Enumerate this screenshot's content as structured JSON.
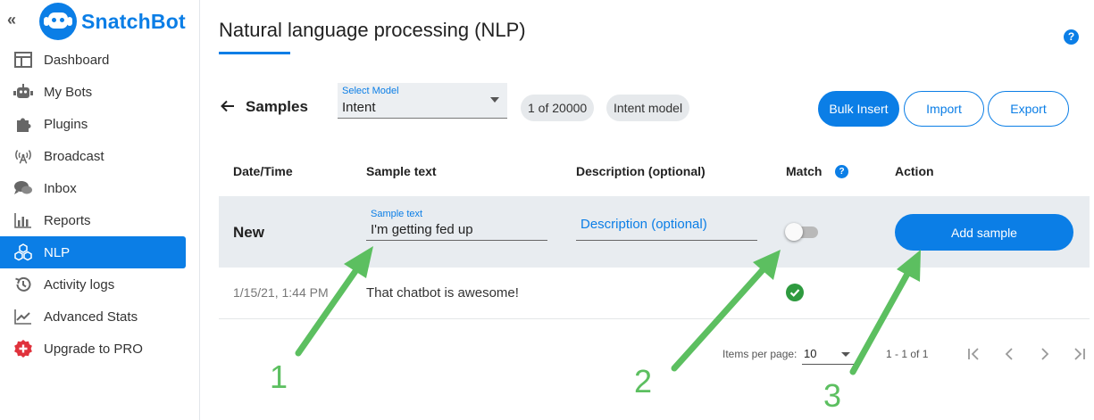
{
  "brand": {
    "name": "SnatchBot"
  },
  "sidebar": {
    "collapse_icon": "double-chevron-left-icon",
    "items": [
      {
        "label": "Dashboard",
        "icon": "dashboard-icon"
      },
      {
        "label": "My Bots",
        "icon": "robot-icon"
      },
      {
        "label": "Plugins",
        "icon": "puzzle-icon"
      },
      {
        "label": "Broadcast",
        "icon": "antenna-icon"
      },
      {
        "label": "Inbox",
        "icon": "chat-icon"
      },
      {
        "label": "Reports",
        "icon": "bar-chart-icon"
      },
      {
        "label": "NLP",
        "icon": "cubes-icon",
        "active": true
      },
      {
        "label": "Activity logs",
        "icon": "history-icon"
      },
      {
        "label": "Advanced Stats",
        "icon": "line-chart-icon"
      },
      {
        "label": "Upgrade to PRO",
        "icon": "plus-badge-icon"
      }
    ]
  },
  "header": {
    "title": "Natural language processing (NLP)",
    "help_icon": "?"
  },
  "toolbar": {
    "section_title": "Samples",
    "select_model": {
      "label": "Select Model",
      "value": "Intent"
    },
    "count_chip": "1 of 20000",
    "model_chip": "Intent model",
    "bulk_insert": "Bulk Insert",
    "import": "Import",
    "export": "Export"
  },
  "table": {
    "headers": {
      "datetime": "Date/Time",
      "sample_text": "Sample text",
      "description": "Description (optional)",
      "match": "Match",
      "action": "Action"
    },
    "match_help": "?",
    "new_row": {
      "label": "New",
      "sample_label": "Sample text",
      "sample_value": "I'm getting fed up",
      "description_placeholder": "Description (optional)",
      "match_on": false,
      "add_button": "Add sample"
    },
    "rows": [
      {
        "datetime": "1/15/21, 1:44 PM",
        "sample_text": "That chatbot is awesome!",
        "match": true
      }
    ]
  },
  "pagination": {
    "items_per_page_label": "Items per page:",
    "items_per_page": "10",
    "range": "1 - 1 of 1"
  },
  "annotations": {
    "one": "1",
    "two": "2",
    "three": "3"
  },
  "colors": {
    "accent": "#0b7ee6",
    "annotation": "#5cbf60",
    "match_ok": "#2e9a3f"
  }
}
